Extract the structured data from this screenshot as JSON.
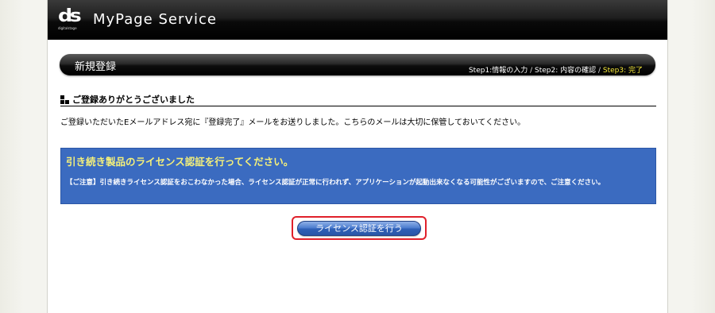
{
  "header": {
    "logo_mark": "ds",
    "logo_small": "digitalstage",
    "app_title": "MyPage Service"
  },
  "title_bar": {
    "section_title": "新規登録",
    "steps": [
      {
        "label": "Step1:情報の入力",
        "current": false
      },
      {
        "label": "Step2: 内容の確認",
        "current": false
      },
      {
        "label": "Step3: 完了",
        "current": true
      }
    ],
    "separator": " / "
  },
  "content": {
    "subheading": "ご登録ありがとうございました",
    "message": "ご登録いただいたEメールアドレス宛に『登録完了』メールをお送りしました。こちらのメールは大切に保管しておいてください。"
  },
  "notice": {
    "title": "引き続き製品のライセンス認証を行ってください。",
    "body": "【ご注意】引き続きライセンス認証をおこわなかった場合、ライセンス認証が正常に行われず、アプリケーションが起動出来なくなる可能性がございますので、ご注意ください。"
  },
  "actions": {
    "license_button_label": "ライセンス認証を行う"
  },
  "colors": {
    "header_bg": "#000000",
    "notice_bg": "#3b6bc0",
    "notice_title": "#f5f07a",
    "current_step": "#f5e83a",
    "button_highlight": "#e0202a"
  }
}
